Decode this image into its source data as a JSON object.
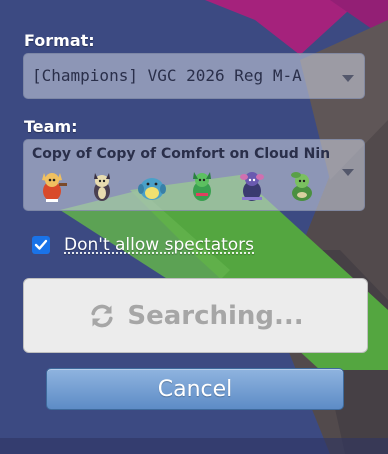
{
  "format": {
    "label": "Format:",
    "value": "[Champions] VGC 2026 Reg M-A"
  },
  "team": {
    "label": "Team:",
    "value": "Copy of Copy of Comfort on Cloud Nin",
    "sprites": [
      "delphox-sprite",
      "indeedee-sprite",
      "dragonite-sprite",
      "meowscarada-sprite",
      "grimmsnarl-sprite",
      "sinistcha-sprite"
    ]
  },
  "spectators": {
    "label": "Don't allow spectators",
    "checked": true
  },
  "search_button": {
    "label": "Searching...",
    "icon": "refresh-icon"
  },
  "cancel_button": {
    "label": "Cancel"
  },
  "colors": {
    "background": "#3d4a82",
    "checkbox": "#1a73e8",
    "cancel_top": "#8fb4df",
    "cancel_bottom": "#5d8cc6"
  }
}
